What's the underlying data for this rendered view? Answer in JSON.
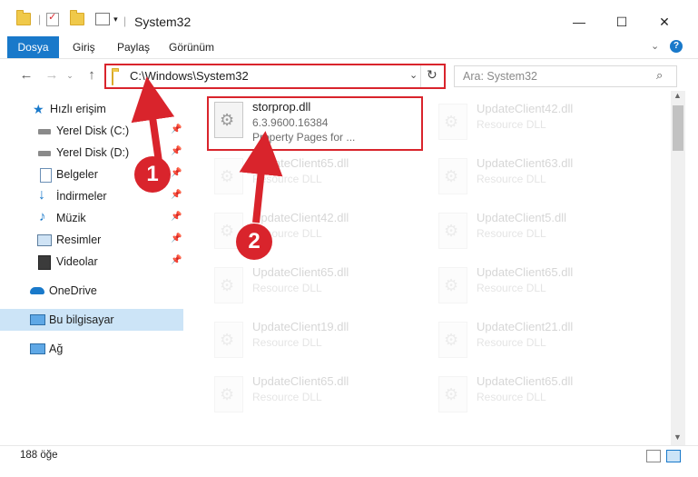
{
  "window": {
    "title": "System32",
    "controls": {
      "minimize": "—",
      "maximize": "☐",
      "close": "✕"
    }
  },
  "ribbon": {
    "tabs": [
      "Dosya",
      "Giriş",
      "Paylaş",
      "Görünüm"
    ]
  },
  "address": {
    "path": "C:\\Windows\\System32",
    "search_placeholder": "Ara: System32"
  },
  "sidebar": {
    "quick_access": "Hızlı erişim",
    "items": [
      {
        "label": "Yerel Disk (C:)",
        "icon": "drive-icon",
        "pinned": true
      },
      {
        "label": "Yerel Disk (D:)",
        "icon": "drive-icon",
        "pinned": true
      },
      {
        "label": "Belgeler",
        "icon": "documents-icon",
        "pinned": true
      },
      {
        "label": "İndirmeler",
        "icon": "download-icon",
        "pinned": true
      },
      {
        "label": "Müzik",
        "icon": "music-icon",
        "pinned": true
      },
      {
        "label": "Resimler",
        "icon": "pictures-icon",
        "pinned": true
      },
      {
        "label": "Videolar",
        "icon": "videos-icon",
        "pinned": true
      }
    ],
    "onedrive": "OneDrive",
    "this_pc": "Bu bilgisayar",
    "network": "Ağ"
  },
  "files": {
    "highlighted": {
      "name": "storprop.dll",
      "version": "6.3.9600.16384",
      "description": "Property Pages for ..."
    },
    "faded": [
      {
        "name": "UpdateClient42.dll",
        "description": "Resource DLL"
      },
      {
        "name": "UpdateClient65.dll",
        "description": "Resource DLL"
      },
      {
        "name": "UpdateClient63.dll",
        "description": "Resource DLL"
      },
      {
        "name": "UpdateClient42.dll",
        "description": "Resource DLL"
      },
      {
        "name": "UpdateClient5.dll",
        "description": "Resource DLL"
      },
      {
        "name": "UpdateClient65.dll",
        "description": "Resource DLL"
      },
      {
        "name": "UpdateClient65.dll",
        "description": "Resource DLL"
      },
      {
        "name": "UpdateClient19.dll",
        "description": "Resource DLL"
      },
      {
        "name": "UpdateClient21.dll",
        "description": "Resource DLL"
      },
      {
        "name": "UpdateClient65.dll",
        "description": "Resource DLL"
      },
      {
        "name": "UpdateClient65.dll",
        "description": "Resource DLL"
      }
    ]
  },
  "status": {
    "item_count": "188 öğe"
  },
  "annotations": {
    "step1": "1",
    "step2": "2"
  },
  "colors": {
    "accent": "#1979ca",
    "highlight": "#d9242c"
  }
}
